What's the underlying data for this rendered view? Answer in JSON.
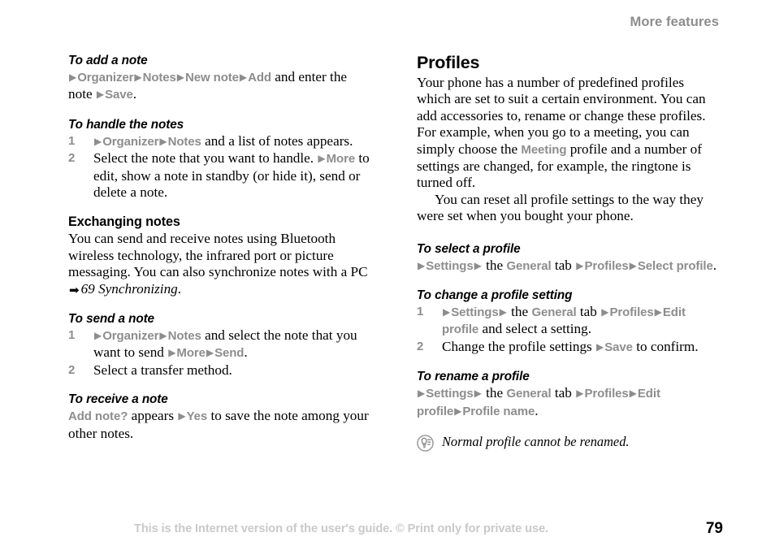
{
  "header": {
    "running_title": "More features"
  },
  "colors": {
    "ui_term_gray": "#8d8d8d",
    "footer_gray": "#c9c9c9",
    "text_black": "#000000",
    "page_background": "#ffffff"
  },
  "icons": {
    "menu_arrow": "▶",
    "cross_reference_arrow": "➡",
    "tip_icon": "tip-bulb-icon"
  },
  "left_column": {
    "task_add_note": {
      "title": "To add a note",
      "line1_tokens": [
        {
          "t": "arrow"
        },
        {
          "t": "ui",
          "v": "Organizer"
        },
        {
          "t": "arrow"
        },
        {
          "t": "ui",
          "v": "Notes"
        },
        {
          "t": "arrow"
        },
        {
          "t": "ui",
          "v": "New note"
        },
        {
          "t": "arrow"
        },
        {
          "t": "ui",
          "v": "Add"
        },
        {
          "t": "txt",
          "v": " and enter the note "
        },
        {
          "t": "arrow"
        },
        {
          "t": "ui",
          "v": "Save"
        },
        {
          "t": "txt",
          "v": "."
        }
      ]
    },
    "task_handle_notes": {
      "title": "To handle the notes",
      "steps": [
        {
          "num": "1",
          "tokens": [
            {
              "t": "arrow"
            },
            {
              "t": "ui",
              "v": "Organizer"
            },
            {
              "t": "arrow"
            },
            {
              "t": "ui",
              "v": "Notes"
            },
            {
              "t": "txt",
              "v": " and a list of notes appears."
            }
          ]
        },
        {
          "num": "2",
          "tokens": [
            {
              "t": "txt",
              "v": "Select the note that you want to handle. "
            },
            {
              "t": "arrow"
            },
            {
              "t": "ui",
              "v": "More"
            },
            {
              "t": "txt",
              "v": " to edit, show a note in standby (or hide it), send or delete a note."
            }
          ]
        }
      ]
    },
    "section_exchanging_notes": {
      "title": "Exchanging notes",
      "body_tokens": [
        {
          "t": "txt",
          "v": "You can send and receive notes using Bluetooth wireless technology, the infrared port or picture messaging. You can also synchronize notes with a PC "
        },
        {
          "t": "bigarrow"
        },
        {
          "t": "xref",
          "v": "69 Synchronizing"
        },
        {
          "t": "txt",
          "v": "."
        }
      ]
    },
    "task_send_note": {
      "title": "To send a note",
      "steps": [
        {
          "num": "1",
          "tokens": [
            {
              "t": "arrow"
            },
            {
              "t": "ui",
              "v": "Organizer"
            },
            {
              "t": "arrow"
            },
            {
              "t": "ui",
              "v": "Notes"
            },
            {
              "t": "txt",
              "v": " and select the note that you want to send "
            },
            {
              "t": "arrow"
            },
            {
              "t": "ui",
              "v": "More"
            },
            {
              "t": "arrow"
            },
            {
              "t": "ui",
              "v": "Send"
            },
            {
              "t": "txt",
              "v": "."
            }
          ]
        },
        {
          "num": "2",
          "tokens": [
            {
              "t": "txt",
              "v": "Select a transfer method."
            }
          ]
        }
      ]
    },
    "task_receive_note": {
      "title": "To receive a note",
      "line1_tokens": [
        {
          "t": "ui",
          "v": "Add note?"
        },
        {
          "t": "txt",
          "v": " appears "
        },
        {
          "t": "arrow"
        },
        {
          "t": "ui",
          "v": "Yes"
        },
        {
          "t": "txt",
          "v": " to save the note among your other notes."
        }
      ]
    }
  },
  "right_column": {
    "section_profiles": {
      "title": "Profiles",
      "paragraph1_tokens": [
        {
          "t": "txt",
          "v": "Your phone has a number of predefined profiles which are set to suit a certain environment. You can add accessories to, rename or change these profiles. For example, when you go to a meeting, you can simply choose the "
        },
        {
          "t": "ui",
          "v": "Meeting"
        },
        {
          "t": "txt",
          "v": " profile and a number of settings are changed, for example, the ringtone is turned off."
        }
      ],
      "paragraph2": "You can reset all profile settings to the way they were set when you bought your phone."
    },
    "task_select_profile": {
      "title": "To select a profile",
      "line1_tokens": [
        {
          "t": "arrow"
        },
        {
          "t": "ui",
          "v": "Settings"
        },
        {
          "t": "arrow"
        },
        {
          "t": "txt",
          "v": " the "
        },
        {
          "t": "ui",
          "v": "General"
        },
        {
          "t": "txt",
          "v": " tab "
        },
        {
          "t": "arrow"
        },
        {
          "t": "ui",
          "v": "Profiles"
        },
        {
          "t": "arrow"
        },
        {
          "t": "ui",
          "v": "Select profile"
        },
        {
          "t": "txt",
          "v": "."
        }
      ]
    },
    "task_change_profile_setting": {
      "title": "To change a profile setting",
      "steps": [
        {
          "num": "1",
          "tokens": [
            {
              "t": "arrow"
            },
            {
              "t": "ui",
              "v": "Settings"
            },
            {
              "t": "arrow"
            },
            {
              "t": "txt",
              "v": " the "
            },
            {
              "t": "ui",
              "v": "General"
            },
            {
              "t": "txt",
              "v": " tab "
            },
            {
              "t": "arrow"
            },
            {
              "t": "ui",
              "v": "Profiles"
            },
            {
              "t": "arrow"
            },
            {
              "t": "ui",
              "v": "Edit profile"
            },
            {
              "t": "txt",
              "v": " and select a setting."
            }
          ]
        },
        {
          "num": "2",
          "tokens": [
            {
              "t": "txt",
              "v": "Change the profile settings "
            },
            {
              "t": "arrow"
            },
            {
              "t": "ui",
              "v": "Save"
            },
            {
              "t": "txt",
              "v": " to confirm."
            }
          ]
        }
      ]
    },
    "task_rename_profile": {
      "title": "To rename a profile",
      "line1_tokens": [
        {
          "t": "arrow"
        },
        {
          "t": "ui",
          "v": "Settings"
        },
        {
          "t": "arrow"
        },
        {
          "t": "txt",
          "v": " the "
        },
        {
          "t": "ui",
          "v": "General"
        },
        {
          "t": "txt",
          "v": " tab "
        },
        {
          "t": "arrow"
        },
        {
          "t": "ui",
          "v": "Profiles"
        },
        {
          "t": "arrow"
        },
        {
          "t": "ui",
          "v": "Edit profile"
        },
        {
          "t": "arrow"
        },
        {
          "t": "ui",
          "v": "Profile name"
        },
        {
          "t": "txt",
          "v": "."
        }
      ]
    },
    "tip_note": {
      "text": "Normal profile cannot be renamed."
    }
  },
  "footer": {
    "notice": "This is the Internet version of the user's guide. © Print only for private use.",
    "page_number": "79"
  }
}
